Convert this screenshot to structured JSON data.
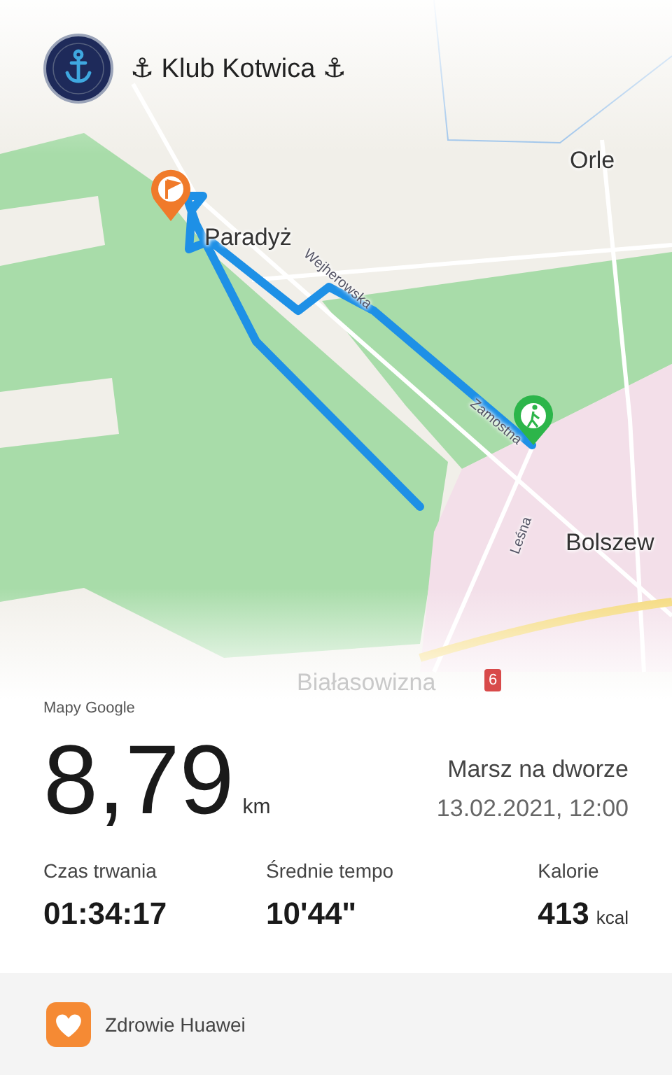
{
  "header": {
    "title": "⚓ Klub Kotwica ⚓"
  },
  "map": {
    "labels": [
      {
        "text": "Orle",
        "kind": "place"
      },
      {
        "text": "Paradyż",
        "kind": "place"
      },
      {
        "text": "Wejherowska",
        "kind": "street"
      },
      {
        "text": "Zamostna",
        "kind": "street"
      },
      {
        "text": "Bolszew",
        "kind": "place"
      },
      {
        "text": "Leśna",
        "kind": "street"
      },
      {
        "text": "Białasowizna",
        "kind": "faded"
      },
      {
        "text": "6",
        "kind": "road-number"
      }
    ],
    "attribution": "Mapy Google"
  },
  "activity": {
    "distance": "8,79",
    "unit": "km",
    "type": "Marsz na dworze",
    "datetime": "13.02.2021, 12:00"
  },
  "stats": [
    {
      "label": "Czas trwania",
      "value": "01:34:17"
    },
    {
      "label": "Średnie tempo",
      "value": "10'44\""
    },
    {
      "label": "Kalorie",
      "value": "413",
      "unit": "kcal"
    }
  ],
  "footer": {
    "app_name": "Zdrowie Huawei"
  }
}
